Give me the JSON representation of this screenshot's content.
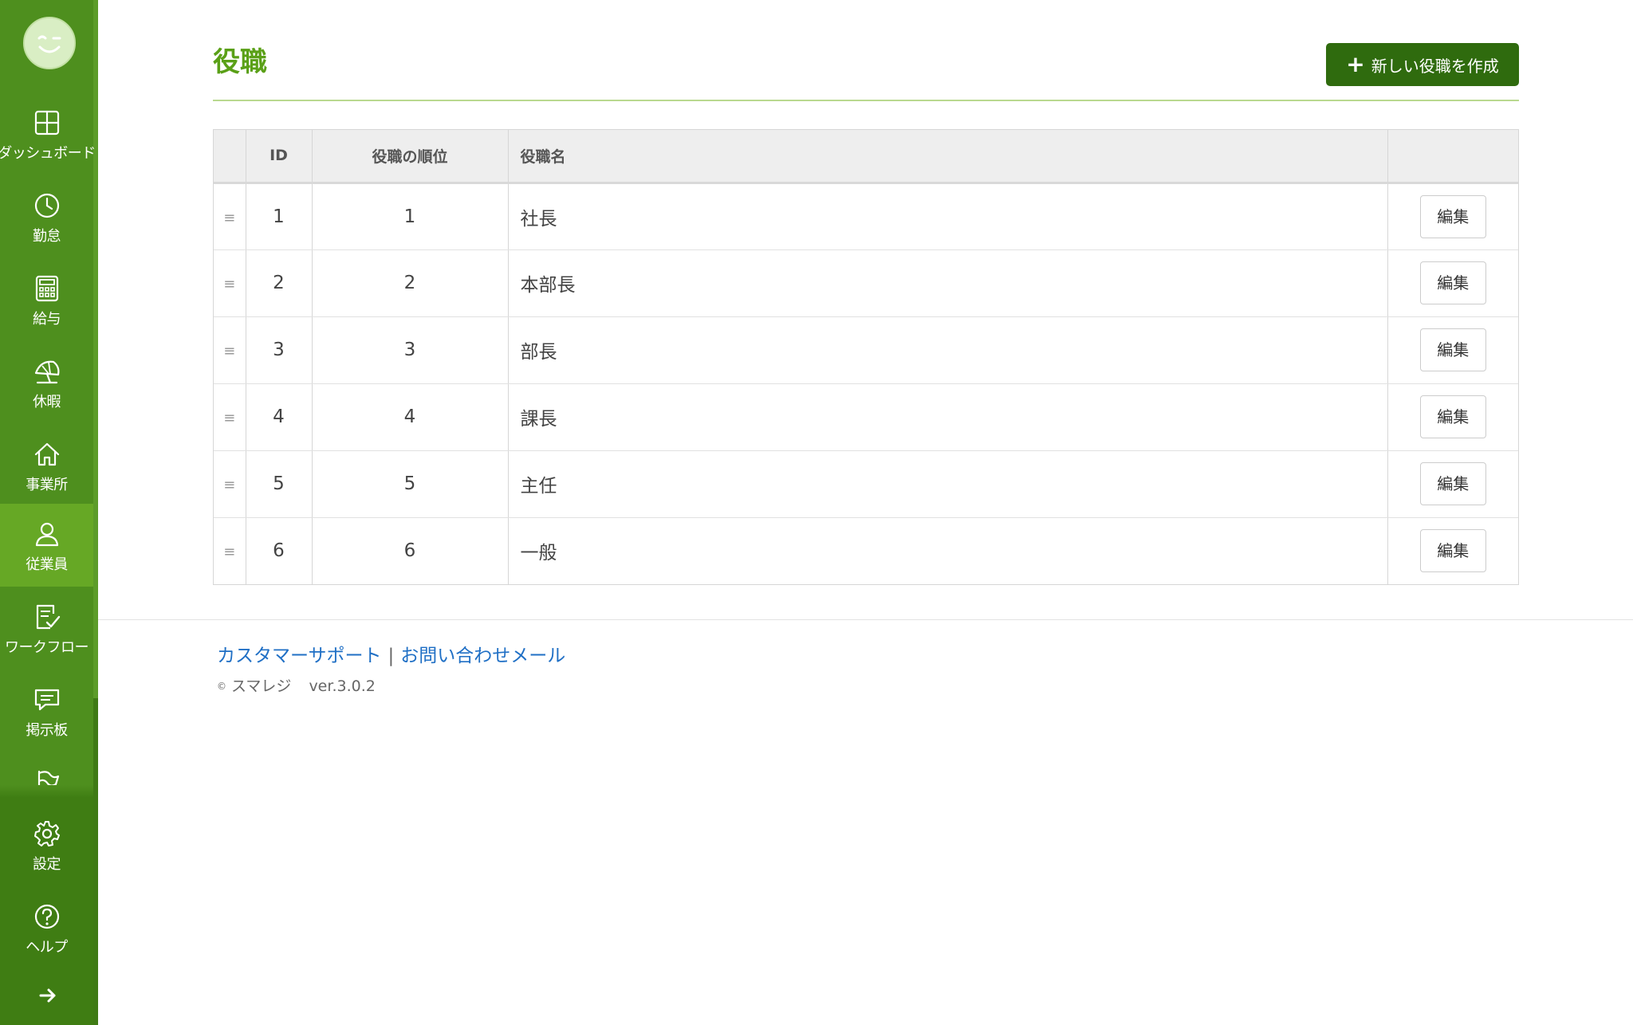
{
  "sidebar": {
    "items": [
      {
        "label": "ダッシュボード",
        "icon": "dashboard-icon"
      },
      {
        "label": "勤怠",
        "icon": "clock-icon"
      },
      {
        "label": "給与",
        "icon": "calculator-icon"
      },
      {
        "label": "休暇",
        "icon": "umbrella-icon"
      },
      {
        "label": "事業所",
        "icon": "home-icon"
      },
      {
        "label": "従業員",
        "icon": "person-icon",
        "active": true
      },
      {
        "label": "ワークフロー",
        "icon": "workflow-icon"
      },
      {
        "label": "掲示板",
        "icon": "message-icon"
      },
      {
        "label": "",
        "icon": "flag-icon"
      },
      {
        "label": "設定",
        "icon": "gear-icon"
      },
      {
        "label": "ヘルプ",
        "icon": "help-icon"
      }
    ],
    "expand_icon": "arrow-right-icon"
  },
  "header": {
    "title": "役職",
    "create_button_label": "新しい役職を作成"
  },
  "table": {
    "columns": [
      "",
      "ID",
      "役職の順位",
      "役職名",
      ""
    ],
    "rows": [
      {
        "id": "1",
        "rank": "1",
        "name": "社長",
        "action": "編集"
      },
      {
        "id": "2",
        "rank": "2",
        "name": "本部長",
        "action": "編集"
      },
      {
        "id": "3",
        "rank": "3",
        "name": "部長",
        "action": "編集"
      },
      {
        "id": "4",
        "rank": "4",
        "name": "課長",
        "action": "編集"
      },
      {
        "id": "5",
        "rank": "5",
        "name": "主任",
        "action": "編集"
      },
      {
        "id": "6",
        "rank": "6",
        "name": "一般",
        "action": "編集"
      }
    ],
    "drag_handle": "≡"
  },
  "footer": {
    "support_link": "カスタマーサポート",
    "separator": "|",
    "mail_link": "お問い合わせメール",
    "copyright_symbol": "©",
    "company": "スマレジ",
    "version": "ver.3.0.2"
  },
  "colors": {
    "sidebar": "#4e8f1e",
    "sidebar_active": "#66a825",
    "title": "#5aa017",
    "button": "#2f6b0e",
    "link": "#1f6fc5"
  }
}
